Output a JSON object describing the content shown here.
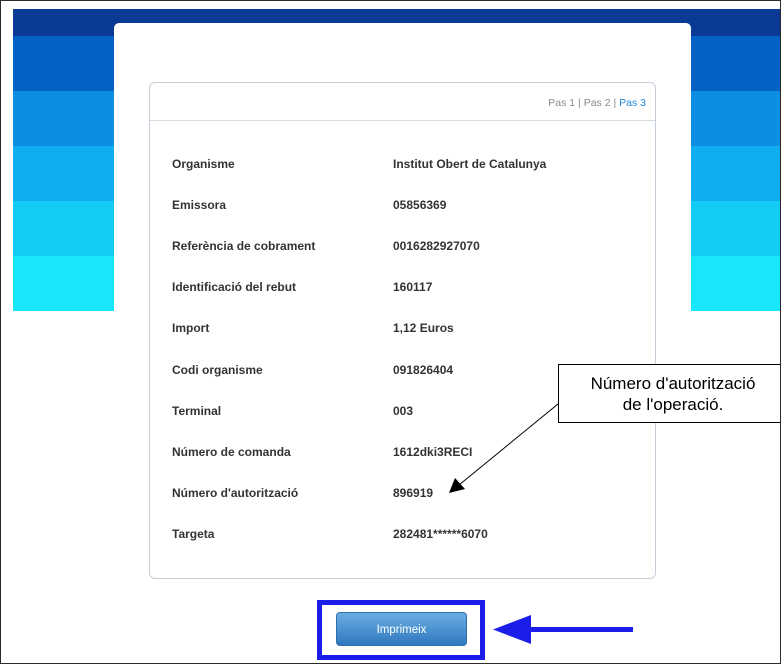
{
  "steps": {
    "step1": "Pas 1",
    "step2": "Pas 2",
    "step3": "Pas 3",
    "separator": "|"
  },
  "rows": [
    {
      "label": "Organisme",
      "value": "Institut Obert de Catalunya"
    },
    {
      "label": "Emissora",
      "value": "05856369"
    },
    {
      "label": "Referència de cobrament",
      "value": "0016282927070"
    },
    {
      "label": "Identificació del rebut",
      "value": "160117"
    },
    {
      "label": "Import",
      "value": "1,12 Euros"
    },
    {
      "label": "Codi organisme",
      "value": "091826404"
    },
    {
      "label": "Terminal",
      "value": "003"
    },
    {
      "label": "Número de comanda",
      "value": "1612dki3RECI"
    },
    {
      "label": "Número d'autorització",
      "value": "896919"
    },
    {
      "label": "Targeta",
      "value": "282481******6070"
    }
  ],
  "print_button": {
    "label": "Imprimeix"
  },
  "callout": {
    "line1": "Número d'autorització",
    "line2": "de l'operació."
  },
  "colors": {
    "highlight": "#1b1ee8",
    "arrow": "#1b1ee8",
    "step_active": "#1e88d8",
    "bands": [
      "#0b3a96",
      "#0461c6",
      "#0c8ee2",
      "#10aef0",
      "#13ccf6",
      "#18e6fb"
    ]
  }
}
